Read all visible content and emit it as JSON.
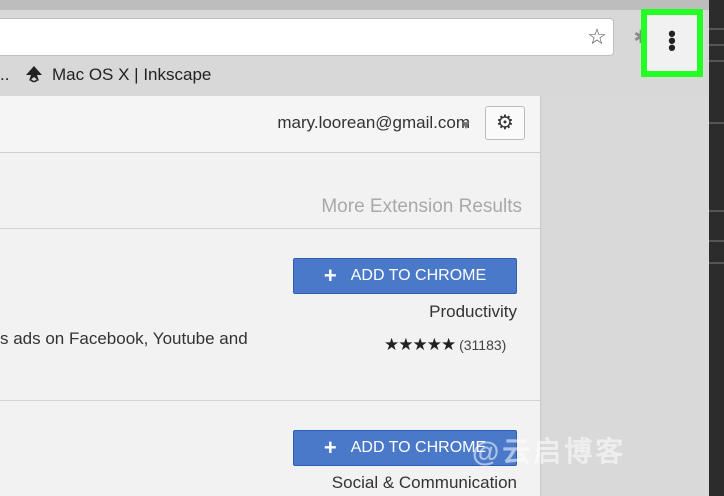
{
  "toolbar": {
    "star_icon": "star-icon",
    "extension_icon": "puzzle-icon",
    "menu_icon": "three-dots-menu-icon",
    "highlight_color": "#22ff22"
  },
  "bookmarks": {
    "ellipsis": "..",
    "items": [
      {
        "label": "Mac OS X | Inkscape",
        "icon": "inkscape-icon"
      }
    ]
  },
  "account": {
    "email": "mary.loorean@gmail.com",
    "settings_icon": "gear-icon"
  },
  "results": {
    "more_label": "More Extension Results",
    "items": [
      {
        "button_label": "ADD TO CHROME",
        "category": "Productivity",
        "description": "s ads on Facebook, Youtube and",
        "stars": "★★★★★",
        "rating_count": "(31183)"
      },
      {
        "button_label": "ADD TO CHROME",
        "category": "Social & Communication"
      }
    ]
  },
  "watermark": "@云启博客",
  "colors": {
    "button_blue": "#4a79c9",
    "page_bg": "#f2f2f2"
  }
}
